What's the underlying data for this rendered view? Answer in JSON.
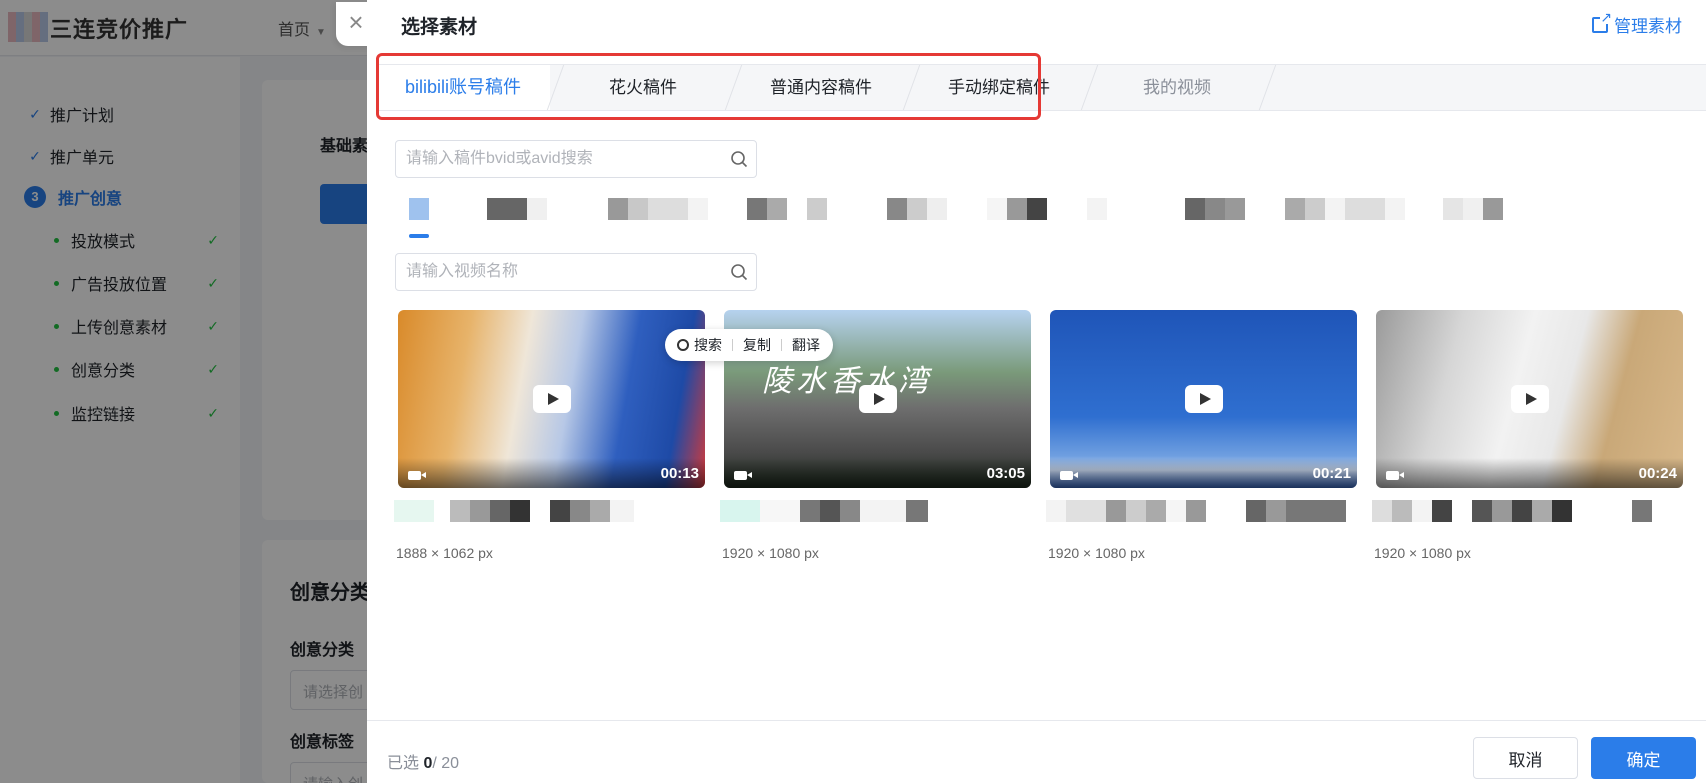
{
  "background": {
    "brand": "三连竞价推广",
    "nav_home": "首页",
    "sidebar": {
      "steps": [
        {
          "label": "推广计划",
          "done": true
        },
        {
          "label": "推广单元",
          "done": true
        },
        {
          "label": "推广创意",
          "number": "3",
          "active": true
        }
      ],
      "substeps": [
        "投放模式",
        "广告投放位置",
        "上传创意素材",
        "创意分类",
        "监控链接"
      ]
    },
    "card1_title": "基础素",
    "card2": {
      "title": "创意分类",
      "field1_label": "创意分类",
      "field1_placeholder": "请选择创",
      "field2_label": "创意标签",
      "field2_placeholder": "请输入创"
    }
  },
  "drawer": {
    "title": "选择素材",
    "manage_link": "管理素材",
    "close_icon": "×",
    "tabs": [
      {
        "label": "bilibili账号稿件",
        "active": true
      },
      {
        "label": "花火稿件"
      },
      {
        "label": "普通内容稿件"
      },
      {
        "label": "手动绑定稿件"
      },
      {
        "label": "我的视频",
        "dim": true
      }
    ],
    "search_bvid_placeholder": "请输入稿件bvid或avid搜索",
    "search_name_placeholder": "请输入视频名称",
    "videos": [
      {
        "duration": "00:13",
        "dims": "1888 × 1062 px",
        "overlay_text": ""
      },
      {
        "duration": "03:05",
        "dims": "1920 × 1080 px",
        "overlay_text": "陵水香水湾"
      },
      {
        "duration": "00:21",
        "dims": "1920 × 1080 px",
        "overlay_text": ""
      },
      {
        "duration": "00:24",
        "dims": "1920 × 1080 px",
        "overlay_text": ""
      }
    ],
    "context_popup": {
      "search": "搜索",
      "copy": "复制",
      "translate": "翻译"
    },
    "footer": {
      "selected_prefix": "已选 ",
      "selected_count": "0",
      "selected_total": "/ 20",
      "cancel": "取消",
      "confirm": "确定"
    }
  },
  "colors": {
    "accent": "#2b7de9",
    "highlight": "#e53935",
    "success": "#23c343"
  }
}
